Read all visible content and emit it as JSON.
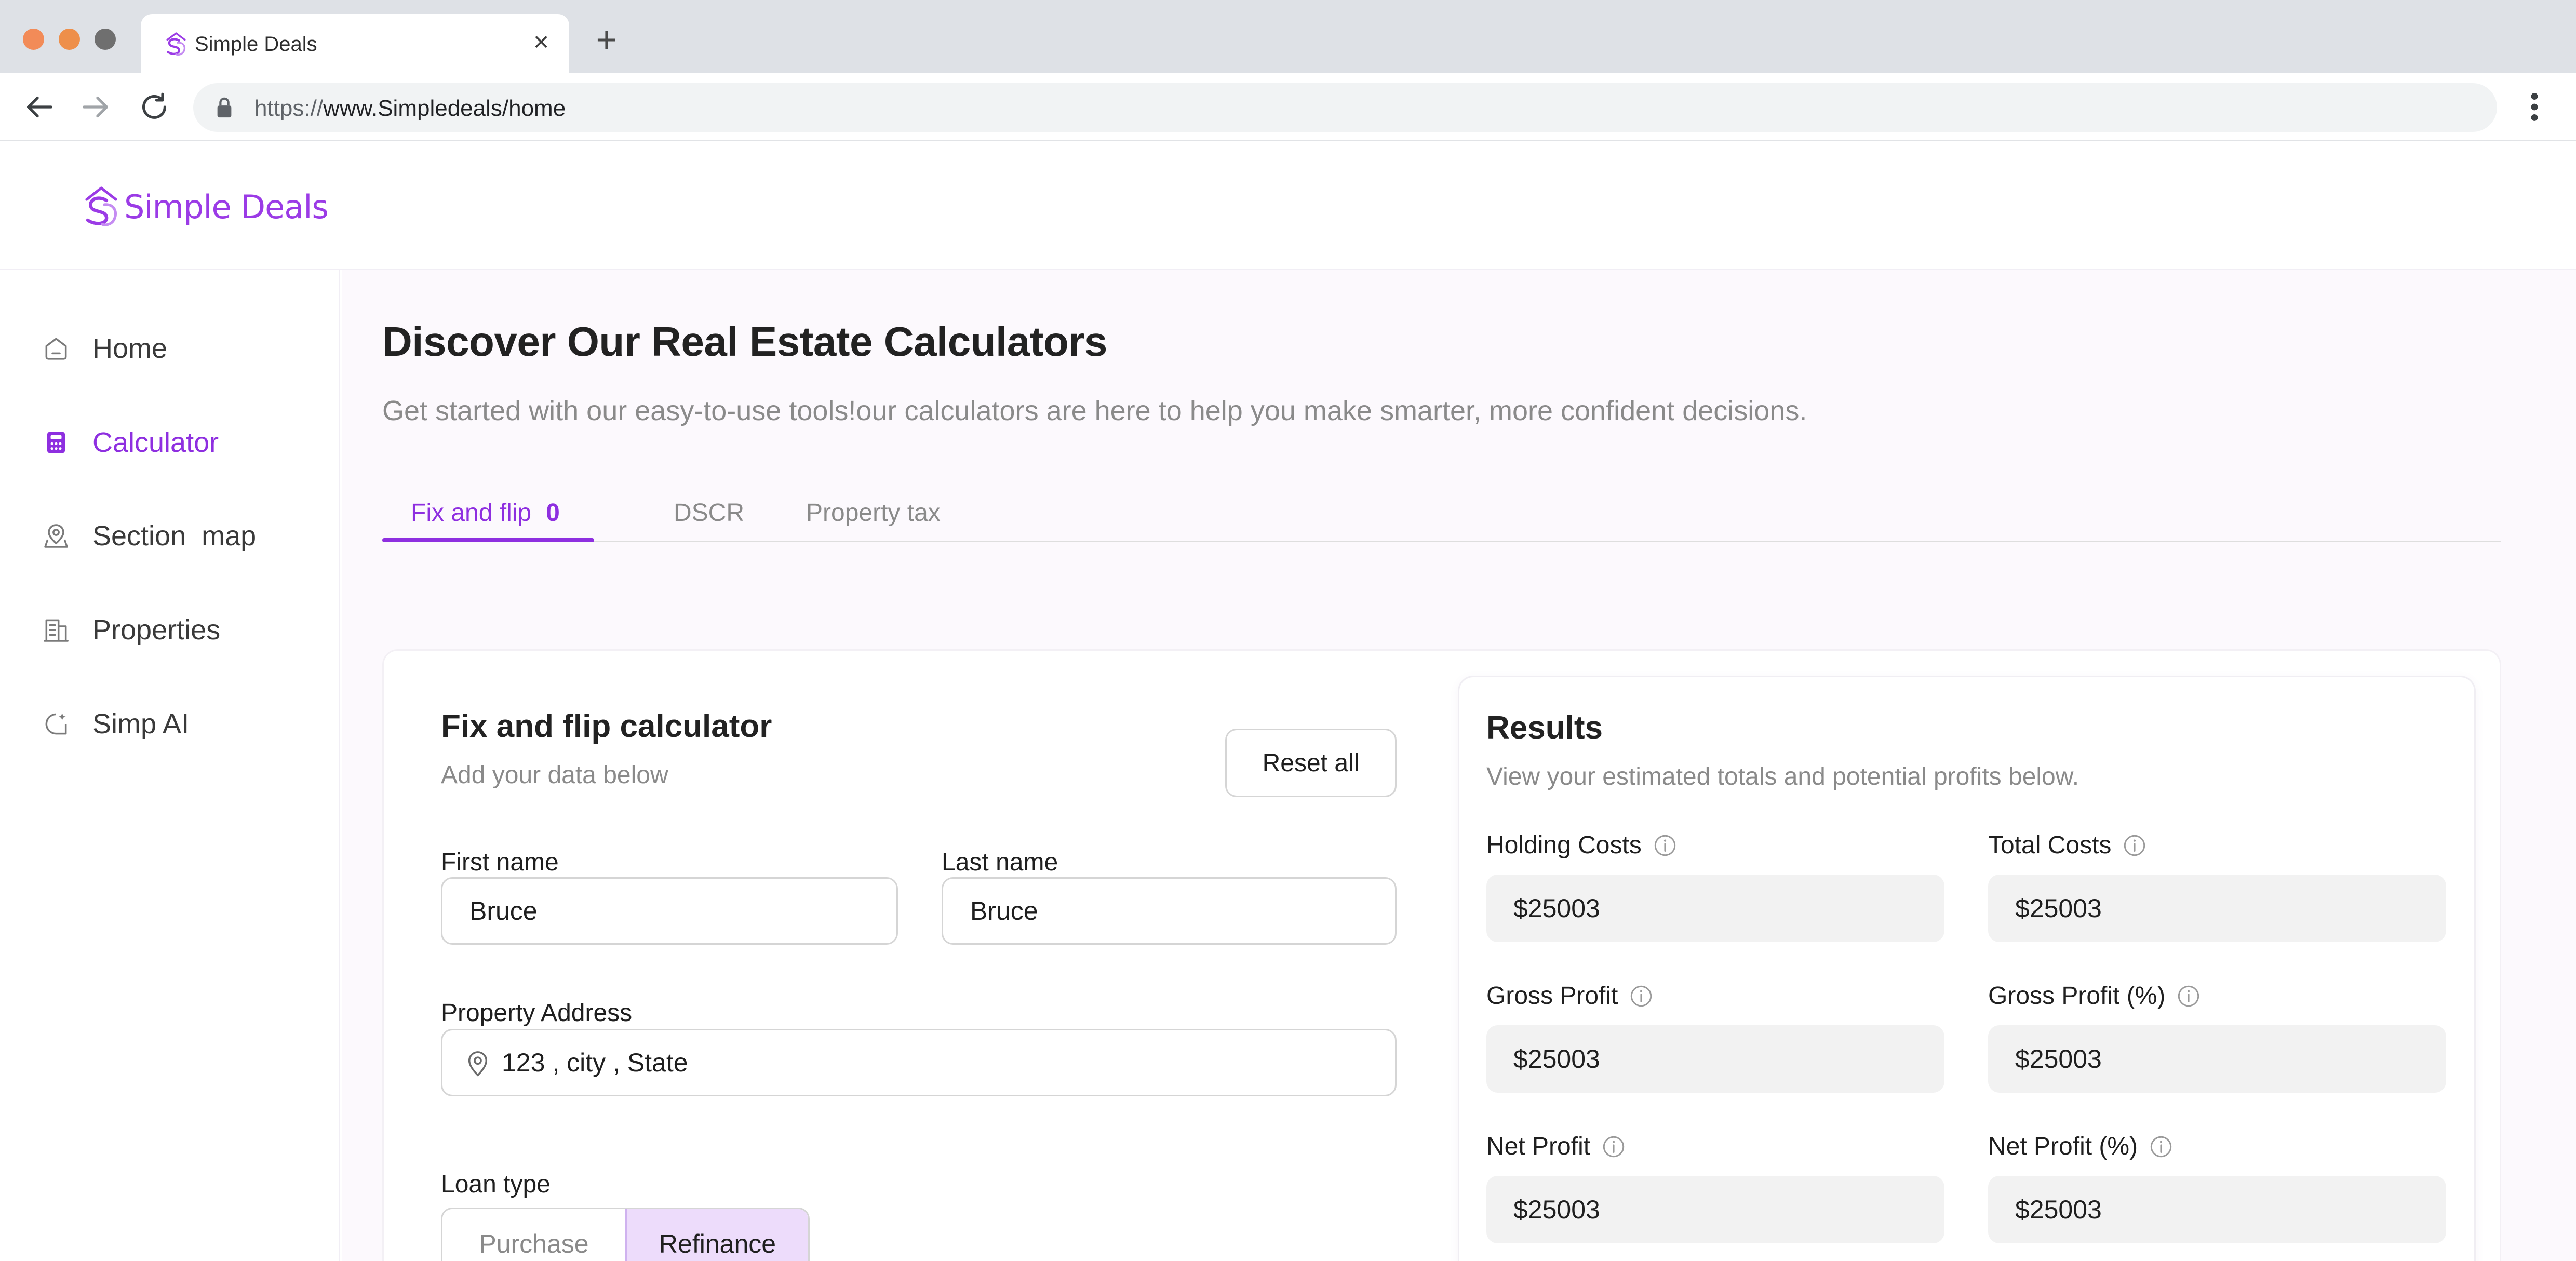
{
  "browser": {
    "tab_title": "Simple Deals",
    "url_scheme": "https://",
    "url_rest": "www.Simpledeals/home"
  },
  "app": {
    "logo_text": "Simple Deals",
    "brand_color": "#8e2fe0"
  },
  "sidebar": {
    "items": [
      {
        "label": "Home",
        "icon": "home-icon",
        "active": false
      },
      {
        "label": "Calculator",
        "icon": "calculator-icon",
        "active": true
      },
      {
        "label": "Section  map",
        "icon": "map-pin-icon",
        "active": false
      },
      {
        "label": "Properties",
        "icon": "building-icon",
        "active": false
      },
      {
        "label": "Simp AI",
        "icon": "ai-chat-icon",
        "active": false
      }
    ]
  },
  "main": {
    "title": "Discover Our Real Estate Calculators",
    "subtitle": "Get started with our easy-to-use tools!our calculators are here to help you make smarter, more confident decisions.",
    "tabs": [
      {
        "label": "Fix and flip",
        "count": "0",
        "active": true
      },
      {
        "label": "DSCR",
        "active": false
      },
      {
        "label": "Property tax",
        "active": false
      }
    ]
  },
  "form": {
    "title": "Fix and flip calculator",
    "subtitle": "Add your data below",
    "reset_label": "Reset all",
    "first_name_label": "First name",
    "first_name_value": "Bruce",
    "last_name_label": "Last name",
    "last_name_value": "Bruce",
    "address_label": "Property Address",
    "address_value": "123 , city , State",
    "loan_type_label": "Loan type",
    "loan_options": [
      "Purchase",
      "Refinance"
    ],
    "loan_selected": "Refinance"
  },
  "results": {
    "title": "Results",
    "subtitle": "View your estimated totals and potential profits below.",
    "items": [
      {
        "label": "Holding Costs",
        "value": "$25003"
      },
      {
        "label": "Total Costs",
        "value": "$25003"
      },
      {
        "label": "Gross Profit",
        "value": "$25003"
      },
      {
        "label": "Gross Profit (%)",
        "value": "$25003"
      },
      {
        "label": "Net Profit",
        "value": "$25003"
      },
      {
        "label": "Net Profit (%)",
        "value": "$25003"
      }
    ]
  }
}
